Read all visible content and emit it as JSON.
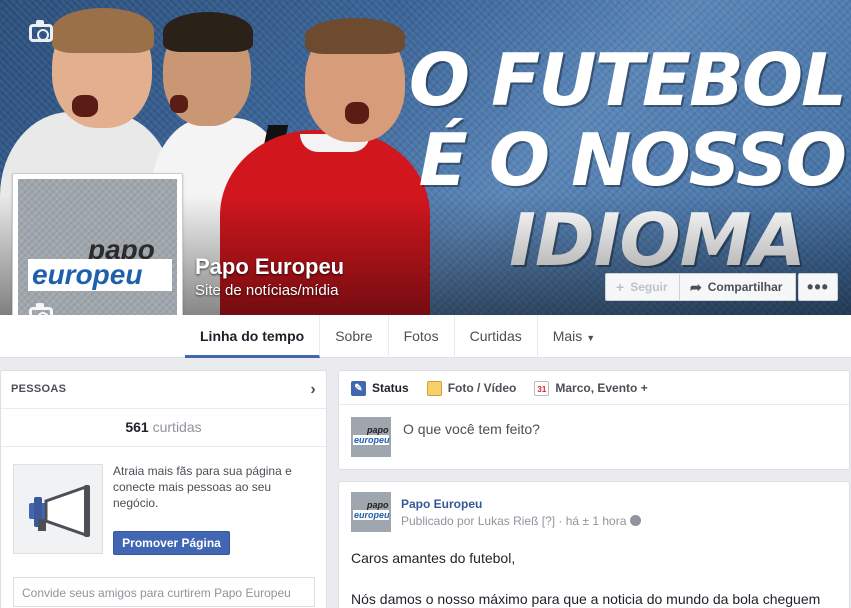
{
  "cover": {
    "headline": [
      "O FUTEBOL",
      "É O NOSSO",
      "IDIOMA"
    ],
    "buttons": {
      "follow": "Seguir",
      "share": "Compartilhar",
      "more": "•••"
    }
  },
  "page": {
    "name": "Papo Europeu",
    "category": "Site de notícias/mídia",
    "logo_top": "papo",
    "logo_bottom": "europeu"
  },
  "nav": {
    "tabs": [
      "Linha do tempo",
      "Sobre",
      "Fotos",
      "Curtidas",
      "Mais"
    ]
  },
  "people": {
    "heading": "PESSOAS",
    "likes_count": "561",
    "likes_label": "curtidas",
    "promo_text": "Atraia mais fãs para sua página e conecte mais pessoas ao seu negócio.",
    "promo_button": "Promover Página",
    "invite_placeholder": "Convide seus amigos para curtirem Papo Europeu"
  },
  "composer": {
    "tabs": [
      "Status",
      "Foto / Vídeo",
      "Marco, Evento +"
    ],
    "placeholder": "O que você tem feito?",
    "calendar_day": "31"
  },
  "post": {
    "author": "Papo Europeu",
    "meta": "Publicado por Lukas Rieß [?] · há ± 1 hora",
    "line1": "Caros amantes do futebol,",
    "line2": "Nós damos o nosso máximo para que a noticia do mundo da bola cheguem"
  }
}
